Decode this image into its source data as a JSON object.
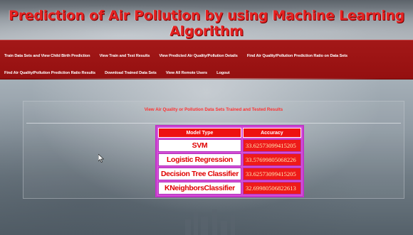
{
  "banner": {
    "title": "Prediction of Air Pollution by using Machine Learning Algorithm"
  },
  "nav": {
    "row1": [
      "Train Data Sets and View Child Birth Prediction",
      "View Train and Test Results",
      "View Predicted Air Quality/Pollution Details",
      "Find Air Quality/Pollution Prediction Ratio on Data Sets"
    ],
    "row2": [
      "Find Air Quality/Pollution Prediction Ratio Results",
      "Download Trained Data Sets",
      "View All Remote Users",
      "Logout"
    ]
  },
  "panel": {
    "heading": "View Air Quality or Pollution Data Sets Trained and Tested Results"
  },
  "results": {
    "headers": [
      "Model Type",
      "Accuracy"
    ],
    "rows": [
      {
        "model": "SVM",
        "accuracy": "33.62573099415205"
      },
      {
        "model": "Logistic Regression",
        "accuracy": "33.57699805068226"
      },
      {
        "model": "Decision Tree Classifier",
        "accuracy": "33.62573099415205"
      },
      {
        "model": "KNeighborsClassifier",
        "accuracy": "32.69980506822613"
      }
    ]
  },
  "colors": {
    "nav_bg": "#a31818",
    "title_red": "#e52222",
    "table_border": "#d44ed8",
    "header_red": "#ee1111"
  },
  "icons": {
    "cursor": "mouse-pointer-icon"
  }
}
